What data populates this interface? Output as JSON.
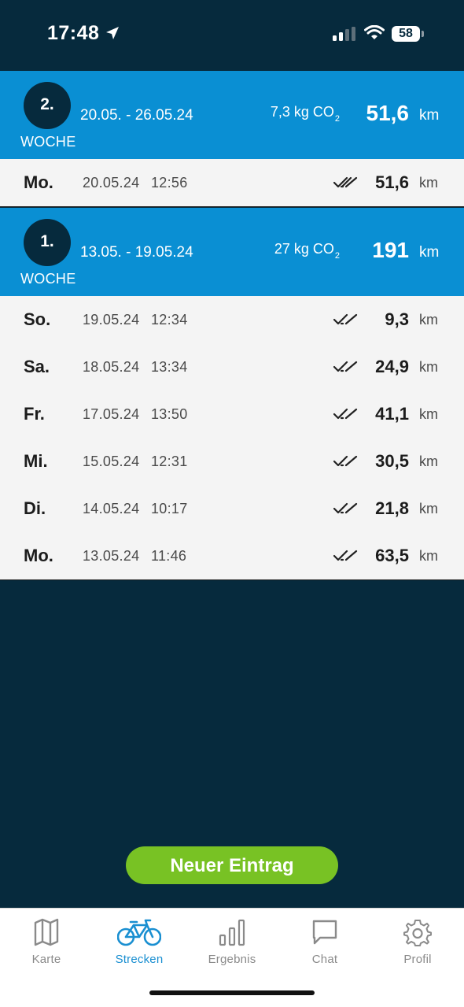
{
  "status": {
    "time": "17:48",
    "battery": "58"
  },
  "weeks": [
    {
      "number": "2.",
      "label": "WOCHE",
      "range": "20.05. - 26.05.24",
      "co2": "7,3 kg CO",
      "co2_sub": "2",
      "km": "51,6",
      "unit": "km",
      "entries": [
        {
          "day": "Mo.",
          "date": "20.05.24",
          "time": "12:56",
          "km": "51,6",
          "unit": "km"
        }
      ]
    },
    {
      "number": "1.",
      "label": "WOCHE",
      "range": "13.05. - 19.05.24",
      "co2": "27 kg CO",
      "co2_sub": "2",
      "km": "191",
      "unit": "km",
      "entries": [
        {
          "day": "So.",
          "date": "19.05.24",
          "time": "12:34",
          "km": "9,3",
          "unit": "km"
        },
        {
          "day": "Sa.",
          "date": "18.05.24",
          "time": "13:34",
          "km": "24,9",
          "unit": "km"
        },
        {
          "day": "Fr.",
          "date": "17.05.24",
          "time": "13:50",
          "km": "41,1",
          "unit": "km"
        },
        {
          "day": "Mi.",
          "date": "15.05.24",
          "time": "12:31",
          "km": "30,5",
          "unit": "km"
        },
        {
          "day": "Di.",
          "date": "14.05.24",
          "time": "10:17",
          "km": "21,8",
          "unit": "km"
        },
        {
          "day": "Mo.",
          "date": "13.05.24",
          "time": "11:46",
          "km": "63,5",
          "unit": "km"
        }
      ]
    }
  ],
  "new_entry_label": "Neuer Eintrag",
  "tabs": [
    {
      "label": "Karte",
      "icon": "map-icon"
    },
    {
      "label": "Strecken",
      "icon": "bicycle-icon",
      "active": true
    },
    {
      "label": "Ergebnis",
      "icon": "bar-chart-icon"
    },
    {
      "label": "Chat",
      "icon": "chat-icon"
    },
    {
      "label": "Profil",
      "icon": "gear-icon"
    }
  ],
  "colors": {
    "background": "#062a3d",
    "accent": "#0a8fd3",
    "button": "#78c224",
    "active_tab": "#1a8fd1"
  }
}
